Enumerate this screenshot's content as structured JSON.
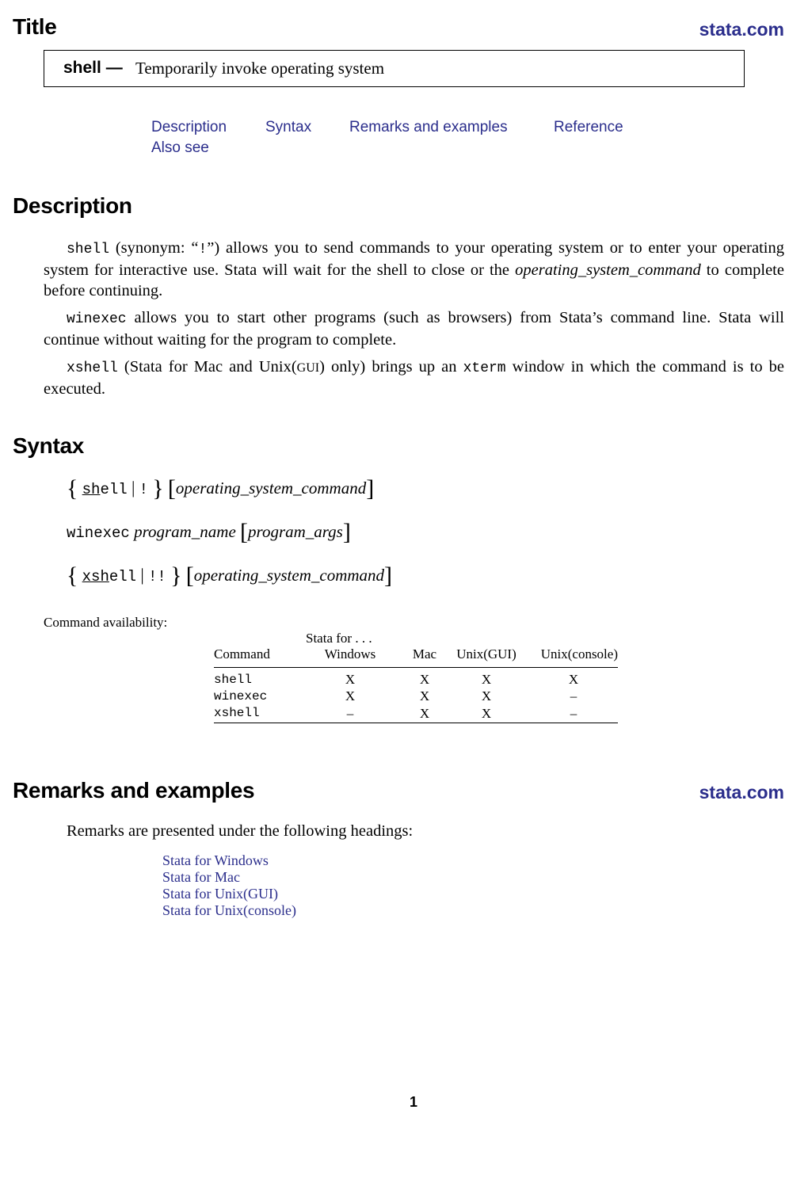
{
  "header": {
    "section_title": "Title",
    "site_link": "stata.com",
    "title_box": {
      "command": "shell —",
      "description": "Temporarily invoke operating system"
    }
  },
  "nav": {
    "links": [
      "Description",
      "Syntax",
      "Remarks and examples",
      "Reference",
      "Also see"
    ]
  },
  "description": {
    "title": "Description",
    "p1": {
      "cmd": "shell",
      "text_a": " (synonym: “",
      "bang": "!",
      "text_b": "”)  allows you to send commands to your operating system or to enter your operating system for interactive use.  Stata will wait for the shell to close or the ",
      "arg": "operating_system_command",
      "text_c": " to complete before continuing."
    },
    "p2": {
      "cmd": "winexec",
      "text": " allows you to start other programs (such as browsers) from Stata’s command line. Stata will continue without waiting for the program to complete."
    },
    "p3": {
      "cmd": "xshell",
      "text_a": " (Stata for Mac and Unix(",
      "gui": "GUI",
      "text_b": ") only) brings up an ",
      "xterm": "xterm",
      "text_c": " window in which the command is to be executed."
    }
  },
  "syntax": {
    "title": "Syntax",
    "line1": {
      "open": "{",
      "cmd_abbrev": "sh",
      "cmd_rest": "ell",
      "sep": "|",
      "alt": "!",
      "close": "}",
      "lb": "[",
      "arg": "operating_system_command",
      "rb": "]"
    },
    "line2": {
      "cmd": "winexec",
      "arg1": "program_name",
      "lb": "[",
      "arg2": "program_args",
      "rb": "]"
    },
    "line3": {
      "open": "{",
      "cmd_abbrev": "xsh",
      "cmd_rest": "ell",
      "sep": "|",
      "alt": "!!",
      "close": "}",
      "lb": "[",
      "arg": "operating_system_command",
      "rb": "]"
    }
  },
  "availability": {
    "label": "Command availability:",
    "group_header": "Stata for . . .",
    "columns": [
      "Command",
      "Windows",
      "Mac",
      "Unix(GUI)",
      "Unix(console)"
    ],
    "rows": [
      {
        "command": "shell",
        "values": [
          "X",
          "X",
          "X",
          "X"
        ]
      },
      {
        "command": "winexec",
        "values": [
          "X",
          "X",
          "X",
          "–"
        ]
      },
      {
        "command": "xshell",
        "values": [
          "–",
          "X",
          "X",
          "–"
        ]
      }
    ]
  },
  "remarks": {
    "title": "Remarks and examples",
    "site_link": "stata.com",
    "intro": "Remarks are presented under the following headings:",
    "headings": [
      "Stata for Windows",
      "Stata for Mac",
      "Stata for Unix(GUI)",
      "Stata for Unix(console)"
    ]
  },
  "footer": {
    "page_number": "1"
  },
  "colors": {
    "link": "#2b2e8c",
    "text": "#000000"
  }
}
